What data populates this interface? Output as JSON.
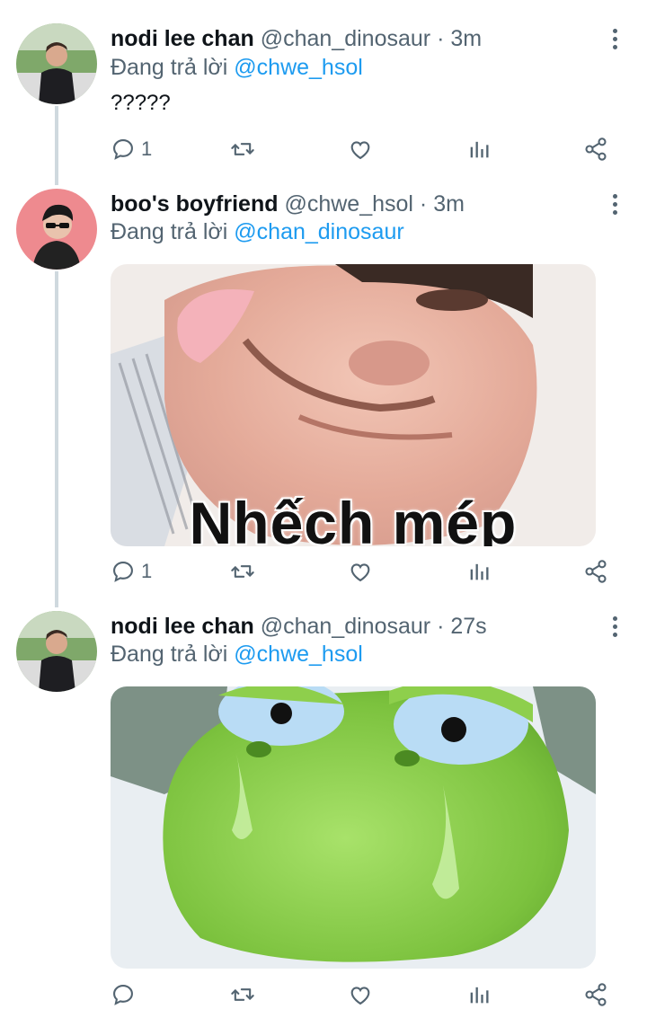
{
  "tweets": [
    {
      "name": "nodi lee chan",
      "handle": "@chan_dinosaur",
      "sep": " · ",
      "time": "3m",
      "reply_prefix": "Đang trả lời ",
      "reply_to": "@chwe_hsol",
      "text": "?????",
      "reply_count": "1",
      "avatar_icon": "profile-photo"
    },
    {
      "name": "boo's boyfriend",
      "handle": "@chwe_hsol",
      "sep": " · ",
      "time": "3m",
      "reply_prefix": "Đang trả lời ",
      "reply_to": "@chan_dinosaur",
      "media_caption": "Nhếch mép",
      "reply_count": "1",
      "avatar_icon": "profile-photo"
    },
    {
      "name": "nodi lee chan",
      "handle": "@chan_dinosaur",
      "sep": " · ",
      "time": "27s",
      "reply_prefix": "Đang trả lời ",
      "reply_to": "@chwe_hsol",
      "reply_count": "",
      "avatar_icon": "profile-photo"
    }
  ],
  "icons": [
    "reply-icon",
    "retweet-icon",
    "like-icon",
    "analytics-icon",
    "share-icon",
    "more-options-icon"
  ],
  "colors": {
    "mention": "#1d9bf0",
    "secondary_text": "#536471",
    "thread_line": "#cfd9de"
  }
}
